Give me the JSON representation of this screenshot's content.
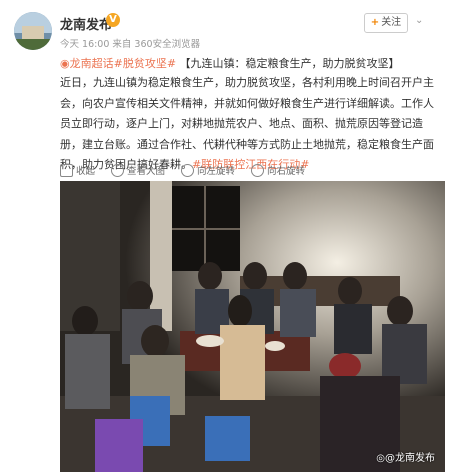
{
  "post": {
    "author": "龙南发布",
    "meta": "今天 16:00 来自 360安全浏览器",
    "follow_label": "关注",
    "hashtags_line": "【九连山镇：稳定粮食生产，助力脱贫攻坚】",
    "tag1": "龙南超话",
    "tag2": "#脱贫攻坚#",
    "body": "近日，九连山镇为稳定粮食生产，助力脱贫攻坚，各村利用晚上时间召开户主会，向农户宣传相关文件精神，并就如何做好粮食生产进行详细解读。工作人员立即行动，逐户上门，对耕地抛荒农户、地点、面积、抛荒原因等登记造册，建立台账。通过合作社、代耕代种等方式防止土地抛荒，稳定粮食生产面积，助力贫困户搞好春耕。",
    "tail_tag": "#联防联控江西在行动#"
  },
  "actions": [
    "收起",
    "查看大图",
    "向左旋转",
    "向右旋转"
  ],
  "watermark": "@龙南发布",
  "icons": [
    "verified-icon",
    "chevron-down-icon",
    "collapse-icon",
    "zoom-icon",
    "rotate-left-icon",
    "rotate-right-icon",
    "weibo-logo-icon"
  ]
}
